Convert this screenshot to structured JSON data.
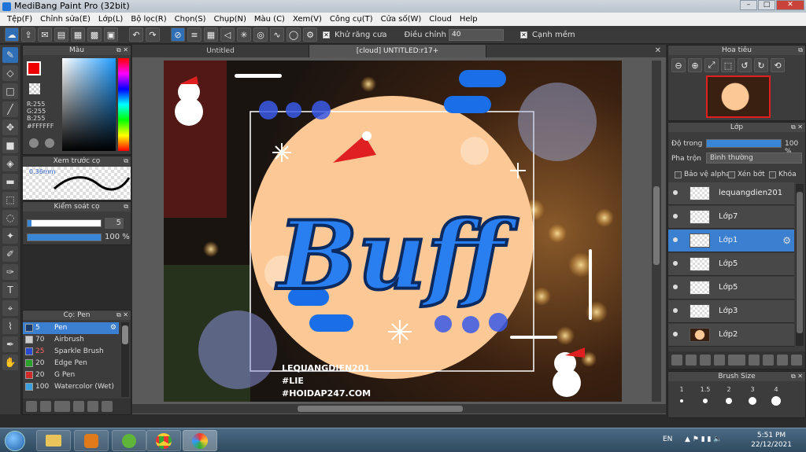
{
  "window": {
    "title": "MediBang Paint Pro (32bit)"
  },
  "menu": [
    "Tệp(F)",
    "Chỉnh sửa(E)",
    "Lớp(L)",
    "Bộ lọc(R)",
    "Chọn(S)",
    "Chụp(N)",
    "Màu (C)",
    "Xem(V)",
    "Công cụ(T)",
    "Cửa số(W)",
    "Cloud",
    "Help"
  ],
  "toolbar": {
    "antialias_label": "Khử răng cưa",
    "adjust_label": "Điều chỉnh",
    "adjust_value": "40",
    "sharp_label": "Cạnh mềm"
  },
  "color_panel": {
    "title": "Màu",
    "r": "R:255",
    "g": "G:255",
    "b": "B:255",
    "hex": "#FFFFFF",
    "main_color": "#ff0000"
  },
  "preview_panel": {
    "title": "Xem trước cọ",
    "size": "0.36mm"
  },
  "brush_control": {
    "title": "Kiểm soát cọ",
    "size_value": "5",
    "opacity_value": "100 %"
  },
  "brush_panel": {
    "title": "Cọ: Pen",
    "items": [
      {
        "num": "5",
        "name": "Pen",
        "color": "#1a3a6a"
      },
      {
        "num": "70",
        "name": "Airbrush",
        "color": "#cccccc"
      },
      {
        "num": "25",
        "name": "Sparkle Brush",
        "color": "#2a4ad0"
      },
      {
        "num": "20",
        "name": "Edge Pen",
        "color": "#2aa02a"
      },
      {
        "num": "20",
        "name": "G Pen",
        "color": "#d02a2a"
      },
      {
        "num": "100",
        "name": "Watercolor (Wet)",
        "color": "#3aa0e0"
      }
    ]
  },
  "tabs": [
    "Untitled",
    "[cloud] UNTITLED:r17+"
  ],
  "artwork": {
    "title_text": "Buff",
    "footer1": "LEQUANGDIEN201",
    "footer2": "#LIE",
    "footer3": "#HOIDAP247.COM"
  },
  "navigator": {
    "title": "Hoa tiêu"
  },
  "layers_panel": {
    "title": "Lớp",
    "opacity_label": "Độ trong",
    "opacity_value": "100 %",
    "blend_label": "Pha trộn",
    "blend_value": "Bình thường",
    "protect_alpha": "Bảo vệ alpha",
    "clipping": "Xén bớt",
    "lock": "Khóa",
    "layers": [
      {
        "name": "lequangdien201",
        "selected": false
      },
      {
        "name": "Lớp7",
        "selected": false
      },
      {
        "name": "Lớp1",
        "selected": true
      },
      {
        "name": "Lớp5",
        "selected": false
      },
      {
        "name": "Lớp5",
        "selected": false
      },
      {
        "name": "Lớp3",
        "selected": false
      },
      {
        "name": "Lớp2",
        "selected": false
      }
    ]
  },
  "brush_size_panel": {
    "title": "Brush Size",
    "sizes": [
      "1",
      "1.5",
      "2",
      "3",
      "4"
    ]
  },
  "taskbar": {
    "language": "EN",
    "time": "5:51 PM",
    "date": "22/12/2021"
  }
}
